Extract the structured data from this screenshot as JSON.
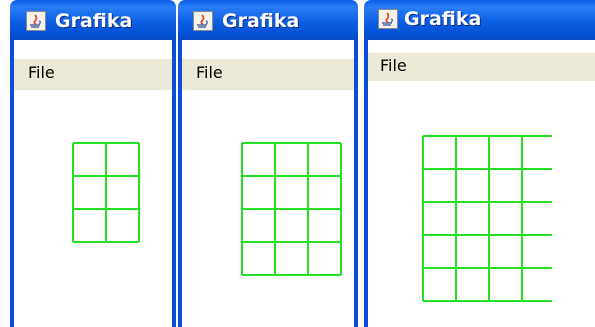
{
  "windows": [
    {
      "title": "Grafika",
      "menu": [
        "File"
      ],
      "grid": {
        "rows": 3,
        "cols": 2
      }
    },
    {
      "title": "Grafika",
      "menu": [
        "File"
      ],
      "grid": {
        "rows": 4,
        "cols": 3
      }
    },
    {
      "title": "Grafika",
      "menu": [
        "File"
      ],
      "grid": {
        "rows": 5,
        "cols": 4
      }
    }
  ],
  "colors": {
    "titlebar": "#0a5ce8",
    "menubar": "#ece9d8",
    "grid_line": "#22e022",
    "frame_border": "#0b4fd8"
  },
  "icons": {
    "app": "java-coffee-cup-icon"
  }
}
